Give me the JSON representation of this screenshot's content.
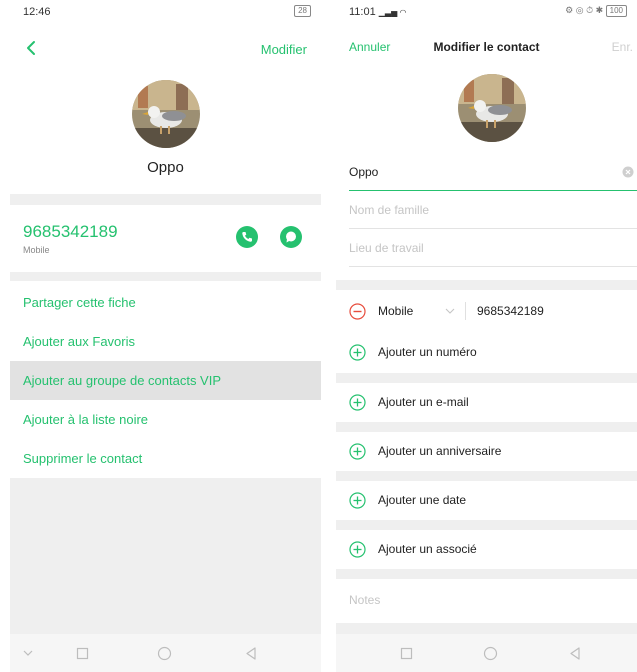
{
  "left": {
    "status": {
      "time": "12:46",
      "battery": "28"
    },
    "header": {
      "edit_label": "Modifier"
    },
    "contact": {
      "name": "Oppo",
      "phone": "9685342189",
      "phone_type": "Mobile"
    },
    "menu": [
      {
        "label": "Partager cette fiche"
      },
      {
        "label": "Ajouter aux Favoris"
      },
      {
        "label": "Ajouter au groupe de contacts VIP"
      },
      {
        "label": "Ajouter à la liste noire"
      },
      {
        "label": "Supprimer le contact"
      }
    ]
  },
  "right": {
    "status": {
      "time": "11:01",
      "battery": "100"
    },
    "header": {
      "cancel": "Annuler",
      "title": "Modifier le contact",
      "save": "Enr."
    },
    "fields": {
      "first_name": "Oppo",
      "last_name_placeholder": "Nom de famille",
      "work_placeholder": "Lieu de travail"
    },
    "phone": {
      "type": "Mobile",
      "number": "9685342189"
    },
    "add_rows": [
      {
        "label": "Ajouter un numéro"
      },
      {
        "label": "Ajouter un e-mail"
      },
      {
        "label": "Ajouter un anniversaire"
      },
      {
        "label": "Ajouter une date"
      },
      {
        "label": "Ajouter un associé"
      }
    ],
    "notes_placeholder": "Notes"
  },
  "colors": {
    "accent": "#25c16f",
    "delete": "#e74c3c",
    "divider": "#efefef",
    "highlight": "#e2e2e2"
  }
}
